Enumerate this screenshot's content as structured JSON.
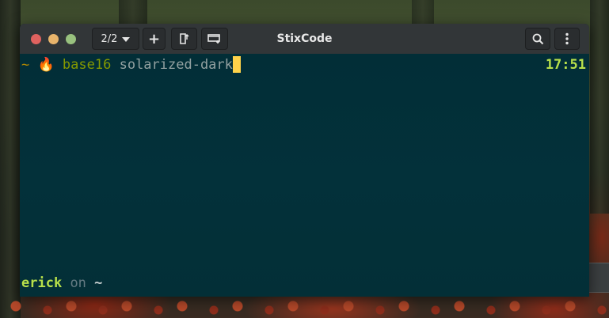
{
  "window": {
    "title": "StixCode",
    "tab_counter": "2/2"
  },
  "toolbar": {
    "add_label": "+",
    "icons": {
      "new_tab": "new-tab-icon",
      "new_window": "new-window-icon",
      "search": "search-icon",
      "menu": "kebab-menu-icon",
      "tab_dropdown": "chevron-down-icon"
    }
  },
  "terminal": {
    "line1": {
      "prompt_tilde": "~",
      "emoji": "🔥",
      "command": "base16",
      "argument": "solarized-dark"
    },
    "clock": "17:51",
    "line2": {
      "user": "erick",
      "on_word": "on",
      "directory": "~"
    }
  },
  "colors": {
    "terminal_bg": "#002b36",
    "cursor": "#ffd24a",
    "user_green": "#b8e04a",
    "command_green": "#859900",
    "argument_gray": "#93a1a1",
    "titlebar": "#323638",
    "close": "#e0625f",
    "minimize": "#e8b46b",
    "maximize": "#98c17e"
  }
}
